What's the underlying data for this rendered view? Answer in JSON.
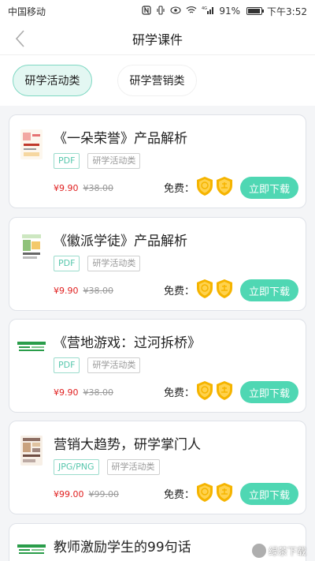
{
  "status_bar": {
    "carrier": "中国移动",
    "nfc_icon": "nfc-icon",
    "vibrate_icon": "vibrate-icon",
    "eye_icon": "eye-icon",
    "wifi_icon": "wifi-icon",
    "network": "4G",
    "battery_percent": "91%",
    "time": "下午3:52"
  },
  "header": {
    "title": "研学课件",
    "back_icon": "chevron-left-icon"
  },
  "tabs": [
    {
      "label": "研学活动类",
      "active": true
    },
    {
      "label": "研学营销类",
      "active": false
    }
  ],
  "colors": {
    "accent": "#4fd7b3",
    "price": "#e02020",
    "badge": "#f5b400"
  },
  "free_label": "免费：",
  "download_label": "立即下载",
  "cards": [
    {
      "title": "《一朵荣誉》产品解析",
      "format": "PDF",
      "category": "研学活动类",
      "price": "¥9.90",
      "old_price": "¥38.00"
    },
    {
      "title": "《徽派学徒》产品解析",
      "format": "PDF",
      "category": "研学活动类",
      "price": "¥9.90",
      "old_price": "¥38.00"
    },
    {
      "title": "《营地游戏：过河拆桥》",
      "format": "PDF",
      "category": "研学活动类",
      "price": "¥9.90",
      "old_price": "¥38.00"
    },
    {
      "title": "营销大趋势，研学掌门人",
      "format": "JPG/PNG",
      "category": "研学活动类",
      "price": "¥99.00",
      "old_price": "¥99.00"
    },
    {
      "title": "教师激励学生的99句话"
    }
  ],
  "watermark": {
    "text": "绿茶下载"
  }
}
